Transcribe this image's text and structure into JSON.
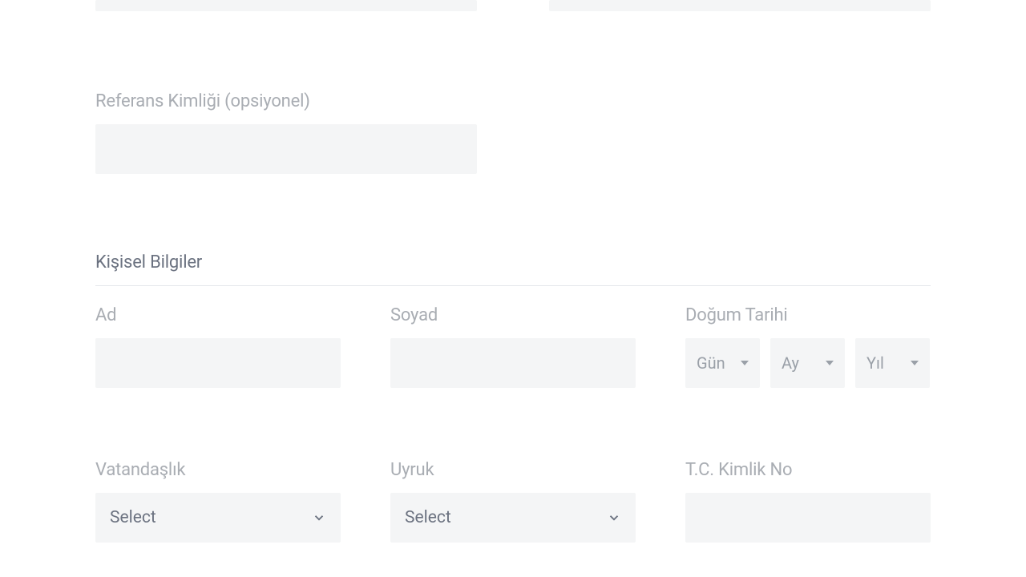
{
  "top_section": {
    "reference_id_label": "Referans Kimliği (opsiyonel)",
    "reference_id_value": ""
  },
  "section": {
    "title": "Kişisel Bilgiler"
  },
  "personal": {
    "first_name_label": "Ad",
    "first_name_value": "",
    "last_name_label": "Soyad",
    "last_name_value": "",
    "birth_date_label": "Doğum Tarihi",
    "day_placeholder": "Gün",
    "month_placeholder": "Ay",
    "year_placeholder": "Yıl",
    "citizenship_label": "Vatandaşlık",
    "citizenship_value": "Select",
    "nationality_label": "Uyruk",
    "nationality_value": "Select",
    "tc_id_label": "T.C. Kimlik No",
    "tc_id_value": ""
  }
}
